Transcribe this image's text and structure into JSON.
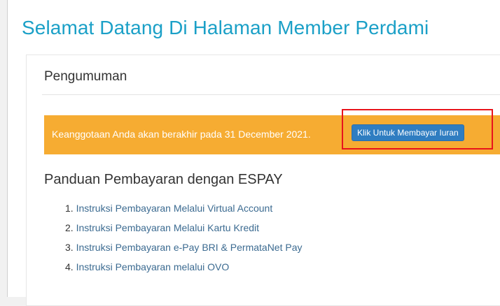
{
  "page": {
    "title": "Selamat Datang Di Halaman Member Perdami"
  },
  "panel": {
    "heading": "Pengumuman"
  },
  "alert": {
    "message": "Keanggotaan Anda akan berakhir pada 31 December 2021.",
    "button_label": "Klik Untuk Membayar Iuran"
  },
  "guide": {
    "heading": "Panduan Pembayaran dengan ESPAY",
    "items": [
      {
        "number": "1.",
        "label": "Instruksi Pembayaran Melalui Virtual Account"
      },
      {
        "number": "2.",
        "label": "Instruksi Pembayaran Melalui Kartu Kredit"
      },
      {
        "number": "3.",
        "label": "Instruksi Pembayaran e-Pay BRI & PermataNet Pay"
      },
      {
        "number": "4.",
        "label": "Instruksi Pembayaran melalui OVO"
      }
    ]
  },
  "colors": {
    "title": "#1ba0c7",
    "alert_background": "#f6ac32",
    "button_background": "#2f7dc1",
    "highlight_border": "#e8141c",
    "link": "#3c6b91"
  }
}
